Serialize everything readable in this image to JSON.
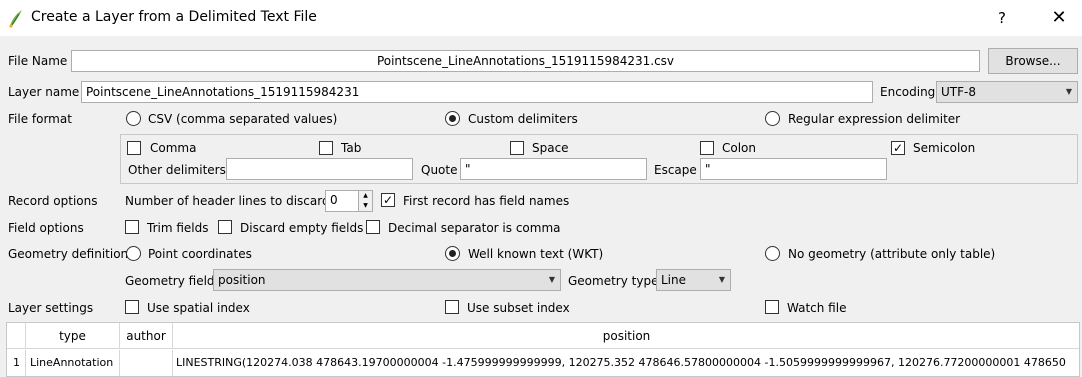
{
  "window": {
    "title": "Create a Layer from a Delimited Text File",
    "help_label": "?",
    "close_label": "✕"
  },
  "file_name": {
    "label": "File Name",
    "value": "Pointscene_LineAnnotations_1519115984231.csv",
    "browse_label": "Browse..."
  },
  "layer_name": {
    "label": "Layer name",
    "value": "Pointscene_LineAnnotations_1519115984231",
    "encoding_label": "Encoding",
    "encoding_value": "UTF-8"
  },
  "file_format": {
    "label": "File format",
    "csv_label": "CSV (comma separated values)",
    "custom_label": "Custom delimiters",
    "regex_label": "Regular expression delimiter",
    "selected": "custom"
  },
  "delimiters": {
    "comma_label": "Comma",
    "tab_label": "Tab",
    "space_label": "Space",
    "colon_label": "Colon",
    "semicolon_label": "Semicolon",
    "semicolon_checked": true,
    "other_label": "Other delimiters",
    "quote_label": "Quote",
    "quote_value": "\"",
    "escape_label": "Escape",
    "escape_value": "\""
  },
  "record_options": {
    "label": "Record options",
    "header_lines_label": "Number of header lines to discard",
    "header_lines_value": "0",
    "first_record_label": "First record has field names",
    "first_record_checked": true
  },
  "field_options": {
    "label": "Field options",
    "trim_label": "Trim fields",
    "discard_label": "Discard empty fields",
    "decimal_label": "Decimal separator is comma"
  },
  "geometry": {
    "label": "Geometry definition",
    "point_label": "Point coordinates",
    "wkt_label": "Well known text (WKT)",
    "none_label": "No geometry (attribute only table)",
    "selected": "wkt",
    "field_label": "Geometry field",
    "field_value": "position",
    "type_label": "Geometry type",
    "type_value": "Line"
  },
  "layer_settings": {
    "label": "Layer settings",
    "spatial_label": "Use spatial index",
    "subset_label": "Use subset index",
    "watch_label": "Watch file"
  },
  "table": {
    "columns": [
      "type",
      "author",
      "position"
    ],
    "rows": [
      {
        "num": "1",
        "type": "LineAnnotation",
        "author": "",
        "position": "LINESTRING(120274.038 478643.19700000004 -1.475999999999999, 120275.352 478646.57800000004 -1.5059999999999967, 120276.77200000001 478650"
      }
    ]
  }
}
